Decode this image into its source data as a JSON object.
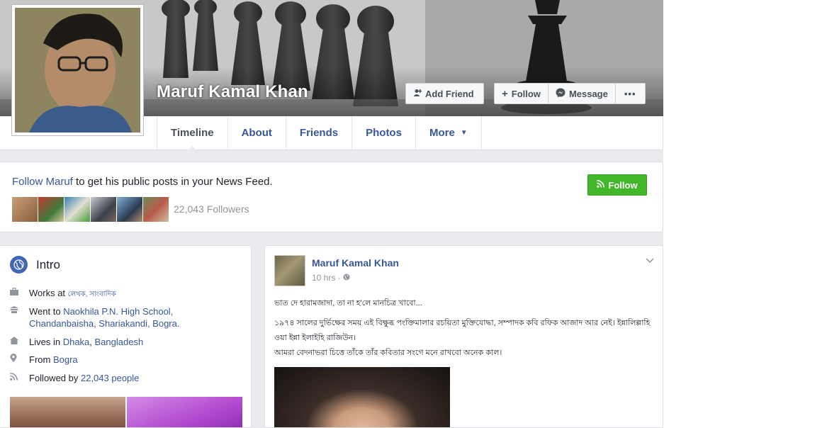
{
  "profile": {
    "name": "Maruf Kamal Khan"
  },
  "header_actions": {
    "add_friend": "Add Friend",
    "follow": "Follow",
    "message": "Message",
    "more_dots": "•••"
  },
  "tabs": [
    {
      "label": "Timeline"
    },
    {
      "label": "About"
    },
    {
      "label": "Friends"
    },
    {
      "label": "Photos"
    },
    {
      "label": "More"
    }
  ],
  "follow_box": {
    "link_text": "Follow Maruf",
    "rest_text": " to get his public posts in your News Feed.",
    "followers": "22,043 Followers",
    "follow_button": "Follow"
  },
  "intro": {
    "title": "Intro",
    "works_prefix": "Works at ",
    "works_value": "লেখক, সাংবাদিক",
    "went_prefix": "Went to ",
    "went_value_1": "Naokhila P.N. High School,",
    "went_value_2": "Chandanbaisha, Shariakandi, Bogra.",
    "lives_prefix": "Lives in ",
    "lives_city": "Dhaka",
    "lives_sep": ", ",
    "lives_country": "Bangladesh",
    "from_prefix": "From ",
    "from_value": "Bogra",
    "followed_prefix": "Followed by ",
    "followed_value": "22,043 people"
  },
  "post": {
    "author": "Maruf Kamal Khan",
    "time": "10 hrs",
    "line1": "ভাত দে হারামজাদা, তা না হ'লে মানচিত্র খাবো...",
    "line2": "১৯৭৪ সালের দুর্ভিক্ষের সময় এই বিক্ষুব্ধ পংক্তিমালার রচয়িতা মুক্তিযোদ্ধা, সম্পাদক কবি রফিক আজাদ আর নেই। ইন্নালিল্লাহি",
    "line3": "ওয়া ইন্না ইলাইহি রাজিউন।",
    "line4": "আমরা বেদনাভরা চিত্তে তাঁকে তাঁর কবিতার সংগে মনে রাখবো অনেক কাল।"
  },
  "icons": {
    "add_friend": "add-friend-icon",
    "follow": "plus-icon",
    "message": "messenger-icon",
    "rss": "rss-icon",
    "globe": "globe-icon",
    "briefcase": "briefcase-icon",
    "school": "school-icon",
    "home": "home-icon",
    "location": "location-pin-icon",
    "chevron": "chevron-down-icon"
  },
  "colors": {
    "link": "#365899",
    "green": "#42b72a",
    "background": "#e9ebee"
  }
}
